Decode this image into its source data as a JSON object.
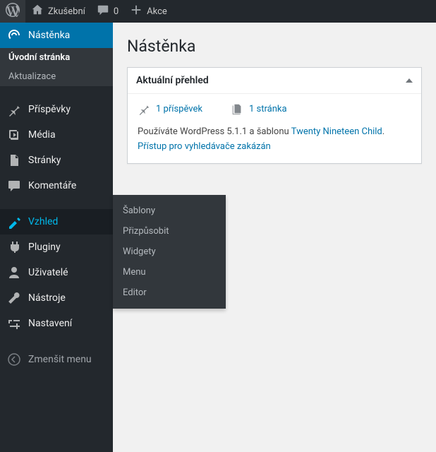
{
  "adminbar": {
    "site_name": "Zkušební",
    "comments_count": "0",
    "new_label": "Akce"
  },
  "sidebar": {
    "dashboard": "Nástěnka",
    "dashboard_sub": {
      "home": "Úvodní stránka",
      "updates": "Aktualizace"
    },
    "posts": "Příspěvky",
    "media": "Média",
    "pages": "Stránky",
    "comments": "Komentáře",
    "appearance": "Vzhled",
    "plugins": "Pluginy",
    "users": "Uživatelé",
    "tools": "Nástroje",
    "settings": "Nastavení",
    "collapse": "Zmenšit menu"
  },
  "flyout": {
    "themes": "Šablony",
    "customize": "Přizpůsobit",
    "widgets": "Widgety",
    "menus": "Menu",
    "editor": "Editor"
  },
  "page": {
    "title": "Nástěnka"
  },
  "glance": {
    "heading": "Aktuální přehled",
    "post_count": "1 příspěvek",
    "page_count": "1 stránka",
    "wp_text_pre": "Používáte WordPress 5.1.1 a šablonu ",
    "theme": "Twenty Nineteen Child",
    "wp_text_post": ".",
    "search_engines": "Přístup pro vyhledávače zakázán"
  }
}
